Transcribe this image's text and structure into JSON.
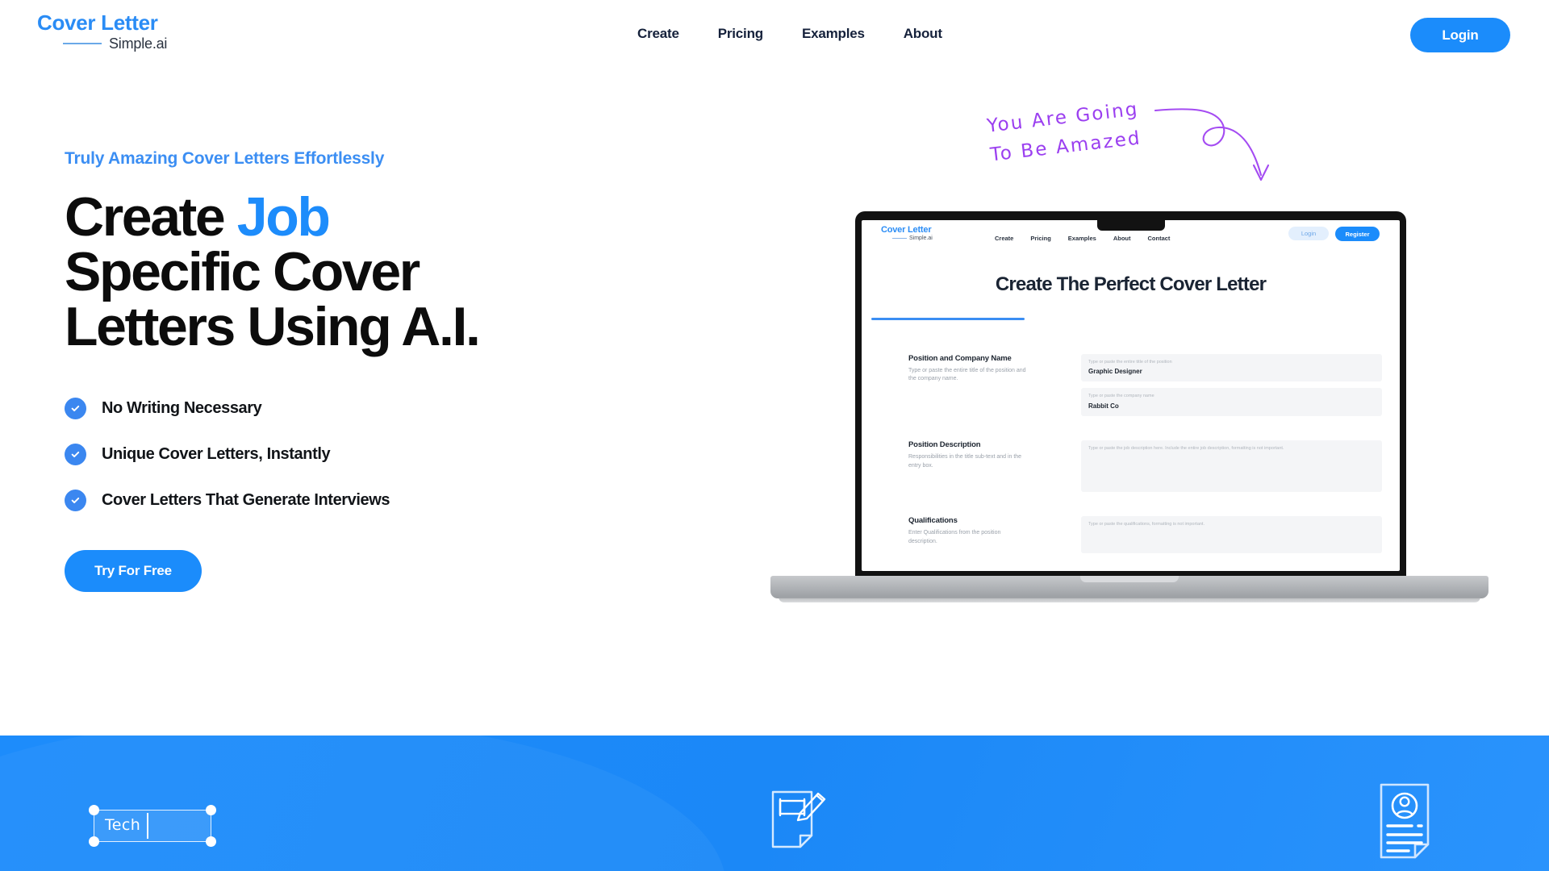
{
  "header": {
    "logo": {
      "main": "Cover Letter",
      "sub": "Simple.ai"
    },
    "nav": [
      {
        "label": "Create"
      },
      {
        "label": "Pricing"
      },
      {
        "label": "Examples"
      },
      {
        "label": "About"
      }
    ],
    "login_label": "Login"
  },
  "hero": {
    "eyebrow": "Truly Amazing Cover Letters Effortlessly",
    "headline_1a": "Create",
    "headline_1b": "Job",
    "headline_2": "Specific Cover",
    "headline_3": "Letters Using A.I.",
    "bullets": [
      {
        "label": "No Writing Necessary"
      },
      {
        "label": "Unique Cover Letters, Instantly"
      },
      {
        "label": "Cover Letters That Generate Interviews"
      }
    ],
    "cta_label": "Try For Free",
    "note": "You Are Going\nTo Be Amazed"
  },
  "laptop": {
    "inner": {
      "logo": {
        "main": "Cover Letter",
        "sub": "Simple.ai"
      },
      "nav": [
        {
          "label": "Create"
        },
        {
          "label": "Pricing"
        },
        {
          "label": "Examples"
        },
        {
          "label": "About"
        },
        {
          "label": "Contact"
        }
      ],
      "login_label": "Login",
      "register_label": "Register",
      "page_title": "Create The Perfect Cover Letter",
      "sections": [
        {
          "title": "Position and Company Name",
          "hint": "Type or paste the entire title of the position and the company name.",
          "fields": [
            {
              "placeholder": "Type or paste the entire title of the position",
              "value": "Graphic Designer"
            },
            {
              "placeholder": "Type or paste the company name",
              "value": "Rabbit Co"
            }
          ]
        },
        {
          "title": "Position Description",
          "hint": "Responsibilities in the title sub-text and in the entry box.",
          "fields": [
            {
              "placeholder": "Type or paste the job description here. Include the entire job description, formatting is not important.",
              "value": ""
            }
          ]
        },
        {
          "title": "Qualifications",
          "hint": "Enter Qualifications from the position description.",
          "fields": [
            {
              "placeholder": "Type or paste the qualifications, formatting is not important.",
              "value": ""
            }
          ]
        }
      ]
    }
  },
  "blue_band": {
    "text_box": {
      "value": "Tech"
    },
    "icons": [
      {
        "name": "document-pencil-icon"
      },
      {
        "name": "resume-profile-icon"
      }
    ]
  },
  "colors": {
    "brand_blue": "#1b8cfb",
    "accent_blue": "#3b8ef3",
    "note_purple": "#9b3ff0",
    "headline_black": "#0c0c0c"
  }
}
